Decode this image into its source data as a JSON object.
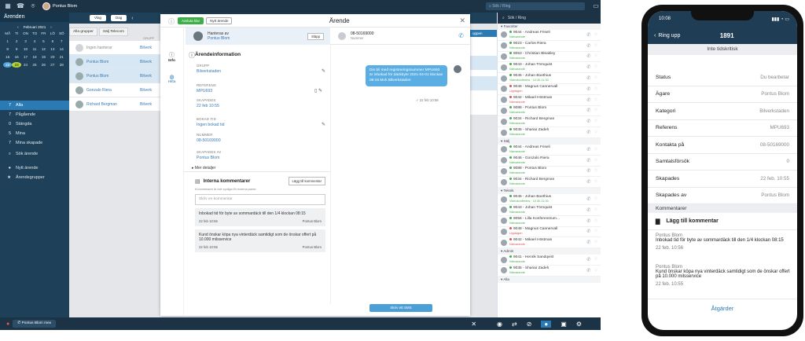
{
  "topbar": {
    "user": "Pontus Blom",
    "search_placeholder": "Sök / Ring"
  },
  "left": {
    "header": "Ärenden",
    "calendar": {
      "month": "Februari 2021",
      "weekdays": [
        "MÅ",
        "TI",
        "ON",
        "TO",
        "FR",
        "LÖ",
        "SÖ"
      ],
      "weeks": [
        [
          "1",
          "2",
          "3",
          "4",
          "5",
          "6",
          "7"
        ],
        [
          "8",
          "9",
          "10",
          "11",
          "12",
          "13",
          "14"
        ],
        [
          "15",
          "16",
          "17",
          "18",
          "19",
          "20",
          "21"
        ],
        [
          "22",
          "23",
          "24",
          "25",
          "26",
          "27",
          "28"
        ]
      ]
    },
    "nav": [
      {
        "count": "7",
        "label": "Alla"
      },
      {
        "count": "7",
        "label": "Pågående"
      },
      {
        "count": "0",
        "label": "Stängda"
      },
      {
        "count": "5",
        "label": "Mina"
      },
      {
        "count": "7",
        "label": "Mina skapade"
      },
      {
        "count": "",
        "label": "Sök ärende"
      },
      {
        "count": "",
        "label": "Nytt ärende"
      },
      {
        "count": "",
        "label": "Ärendegrupper"
      }
    ]
  },
  "toolbar": {
    "view": "Vlag",
    "period": "Dag"
  },
  "list": {
    "tabs": [
      "Alla grupper",
      "Sälj Telecom"
    ],
    "column": "GRUPP",
    "rows": [
      {
        "name": "Ingen hanterar",
        "group": "Bilverk"
      },
      {
        "name": "Pontus Blom",
        "group": "Bilverk"
      },
      {
        "name": "Pontus Blom",
        "group": "Bilverk"
      },
      {
        "name": "Gonzalo Riera",
        "group": "Bilverk"
      },
      {
        "name": "Richard Bergman",
        "group": "Bilverk"
      }
    ],
    "right_tab": "uppen"
  },
  "modal": {
    "title": "Ärende",
    "btn_close": "Avsluta klar",
    "btn_new": "Nytt ärende",
    "handled_label": "Hanteras av",
    "handled_by": "Pontus Blom",
    "release": "Släpp",
    "tab_info": "Info",
    "tab_help": "Hitta",
    "info_title": "Ärendeinformation",
    "fields": [
      {
        "label": "GRUPP",
        "value": "Bilverkstaden"
      },
      {
        "label": "REFERENS",
        "value": "MPU693"
      },
      {
        "label": "SKAPADES",
        "value": "22 feb 10:55"
      },
      {
        "label": "BOKAD TID",
        "value": "Ingen bokad tid"
      },
      {
        "label": "NUMMER",
        "value": "08-50169000"
      },
      {
        "label": "SKAPADES AV",
        "value": "Pontus Blom"
      }
    ],
    "more": "Mer detaljer",
    "comments_title": "Interna kommentarer",
    "comments_hint": "Kommentarer är inte synliga för externa parter.",
    "add_comment": "Lägg till kommentar",
    "comment_placeholder": "Skriv en kommentar",
    "comments": [
      {
        "text": "Inbokad tid för byte av sommardäck till den 1/4 klockan 08:15",
        "date": "22 feb 10:56",
        "author": "Pontus Blom"
      },
      {
        "text": "Kund önskar köpa nya vinterdäck samtidigt som de önskar offert på 10.000 milsservice",
        "date": "22 feb 10:55",
        "author": "Pontus Blom"
      }
    ],
    "chat_number": "08-50169000",
    "chat_sub": "Nummer",
    "bubble": "Din bil med registreringsnummer MPU693 är inbokad för däckbyte 2021-04-01 klockan 08:15 Mvh Bilverkstaden",
    "bubble_time": "22 feb 10:58",
    "sms_button": "Skriv ett SMS"
  },
  "bottombar": {
    "status": "Pontus Blom mex"
  },
  "contacts": [
    {
      "section": "Favoriter",
      "items": [
        {
          "name": "9044 - Andreas Friseli",
          "status": "Närvarande",
          "busy": false
        },
        {
          "name": "9023 - Carlos Riera",
          "status": "Närvarande",
          "busy": false
        },
        {
          "name": "9053 - Christian Bleakley",
          "status": "Närvarande",
          "busy": false
        },
        {
          "name": "9043 - Johan Törnquist",
          "status": "Närvarande",
          "busy": false
        },
        {
          "name": "9045 - Johan Boethius",
          "status": "Videokonferens · 10:30-11:30",
          "busy": false
        },
        {
          "name": "9048 - Magnus Cannervall",
          "status": "Upptagen",
          "busy": true
        },
        {
          "name": "9042 - Mikael Höstman",
          "status": "Närvarande",
          "busy": true
        },
        {
          "name": "9088 - Pontus Blom",
          "status": "Närvarande",
          "busy": false
        },
        {
          "name": "9034 - Richard Bergman",
          "status": "Närvarande",
          "busy": false
        },
        {
          "name": "9035 - Shariar Zadeh",
          "status": "Närvarande",
          "busy": false
        }
      ]
    },
    {
      "section": "Sälj",
      "items": [
        {
          "name": "9044 - Andreas Friseli",
          "status": "Närvarande",
          "busy": false
        },
        {
          "name": "9046 - Gonzalo Riera",
          "status": "Närvarande",
          "busy": false
        },
        {
          "name": "9088 - Pontus Blom",
          "status": "Närvarande",
          "busy": false
        },
        {
          "name": "9034 - Richard Bergman",
          "status": "Närvarande",
          "busy": false
        }
      ]
    },
    {
      "section": "Teknik",
      "items": [
        {
          "name": "9045 - Johan Boethius",
          "status": "Videokonferens · 10:30-11:30",
          "busy": false
        },
        {
          "name": "9043 - Johan Törnquist",
          "status": "Närvarande",
          "busy": false
        },
        {
          "name": "9056 - Lilla Konferensrum...",
          "status": "Närvarande",
          "busy": false
        },
        {
          "name": "9048 - Magnus Cannervall",
          "status": "Upptagen",
          "busy": true
        },
        {
          "name": "9042 - Mikael Höstman",
          "status": "Närvarande",
          "busy": true
        }
      ]
    },
    {
      "section": "Admin",
      "items": [
        {
          "name": "9041 - Henrik Sandqvist",
          "status": "Närvarande",
          "busy": false
        },
        {
          "name": "9035 - Shariar Zadeh",
          "status": "Närvarande",
          "busy": false
        }
      ]
    },
    {
      "section": "Alla",
      "items": []
    }
  ],
  "phone": {
    "time": "10:08",
    "back": "Ring upp",
    "title": "1891",
    "subtitle": "Inte tidskritisk",
    "rows": [
      {
        "label": "Status",
        "value": "Du bearbetar"
      },
      {
        "label": "Ägare",
        "value": "Pontus Blom"
      },
      {
        "label": "Kategori",
        "value": "Bilverkstaden"
      },
      {
        "label": "Referens",
        "value": "MPU693"
      },
      {
        "label": "Kontakta på",
        "value": "08-50169000"
      },
      {
        "label": "Samtalsförsök",
        "value": "0"
      },
      {
        "label": "Skapades",
        "value": "22 feb. 10:55"
      },
      {
        "label": "Skapades av",
        "value": "Pontus Blom"
      }
    ],
    "comments_header": "Kommentarer",
    "add_comment": "Lägg till kommentar",
    "comments": [
      {
        "author": "Pontus Blom",
        "text": "Inbokad tid för byte av sommardäck till den 1/4 klockan 08:15",
        "date": "22 feb. 10:56"
      },
      {
        "author": "Pontus Blom",
        "text": "Kund önskar köpa nya vinterdäck samtidigt som de önskar offert på 10.000 milsservice",
        "date": "22 feb. 10:55"
      }
    ],
    "actions": "Åtgärder"
  }
}
